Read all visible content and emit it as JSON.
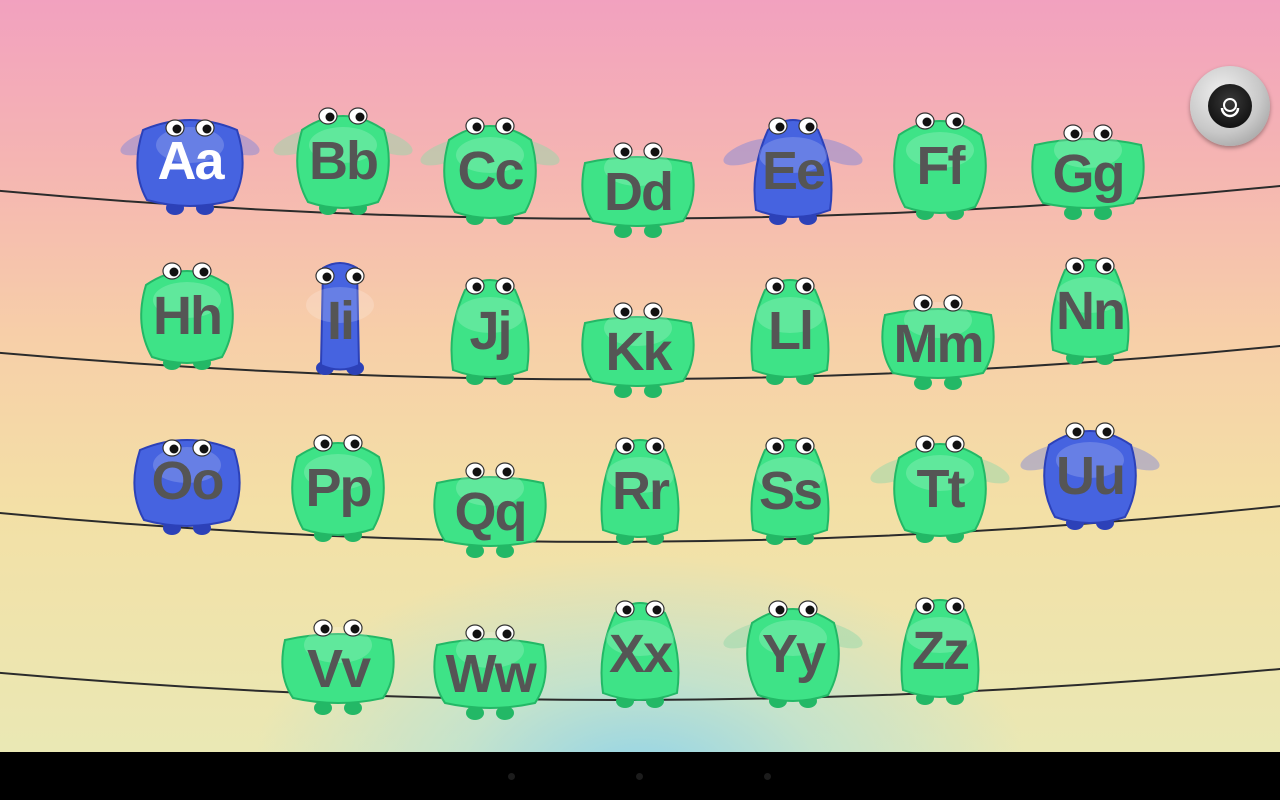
{
  "colors": {
    "green_body": "#3ee387",
    "green_dark": "#23b866",
    "blue_body": "#4663e0",
    "blue_dark": "#2c41b8",
    "letter_gray": "#555555",
    "wire": "#2b2b2b"
  },
  "alphabet": [
    {
      "label": "Aa",
      "color": "blue",
      "white": true
    },
    {
      "label": "Bb",
      "color": "green"
    },
    {
      "label": "Cc",
      "color": "green"
    },
    {
      "label": "Dd",
      "color": "green"
    },
    {
      "label": "Ee",
      "color": "blue"
    },
    {
      "label": "Ff",
      "color": "green"
    },
    {
      "label": "Gg",
      "color": "green"
    },
    {
      "label": "Hh",
      "color": "green"
    },
    {
      "label": "Ii",
      "color": "blue"
    },
    {
      "label": "Jj",
      "color": "green"
    },
    {
      "label": "Kk",
      "color": "green"
    },
    {
      "label": "Ll",
      "color": "green"
    },
    {
      "label": "Mm",
      "color": "green"
    },
    {
      "label": "Nn",
      "color": "green"
    },
    {
      "label": "Oo",
      "color": "blue"
    },
    {
      "label": "Pp",
      "color": "green"
    },
    {
      "label": "Qq",
      "color": "green"
    },
    {
      "label": "Rr",
      "color": "green"
    },
    {
      "label": "Ss",
      "color": "green"
    },
    {
      "label": "Tt",
      "color": "green"
    },
    {
      "label": "Uu",
      "color": "blue"
    },
    {
      "label": "Vv",
      "color": "green"
    },
    {
      "label": "Ww",
      "color": "green"
    },
    {
      "label": "Xx",
      "color": "green"
    },
    {
      "label": "Yy",
      "color": "green"
    },
    {
      "label": "Zz",
      "color": "green"
    }
  ],
  "settings_icon": "settings-knob-icon",
  "nav_icons": [
    "back-icon",
    "home-icon",
    "recents-icon"
  ]
}
